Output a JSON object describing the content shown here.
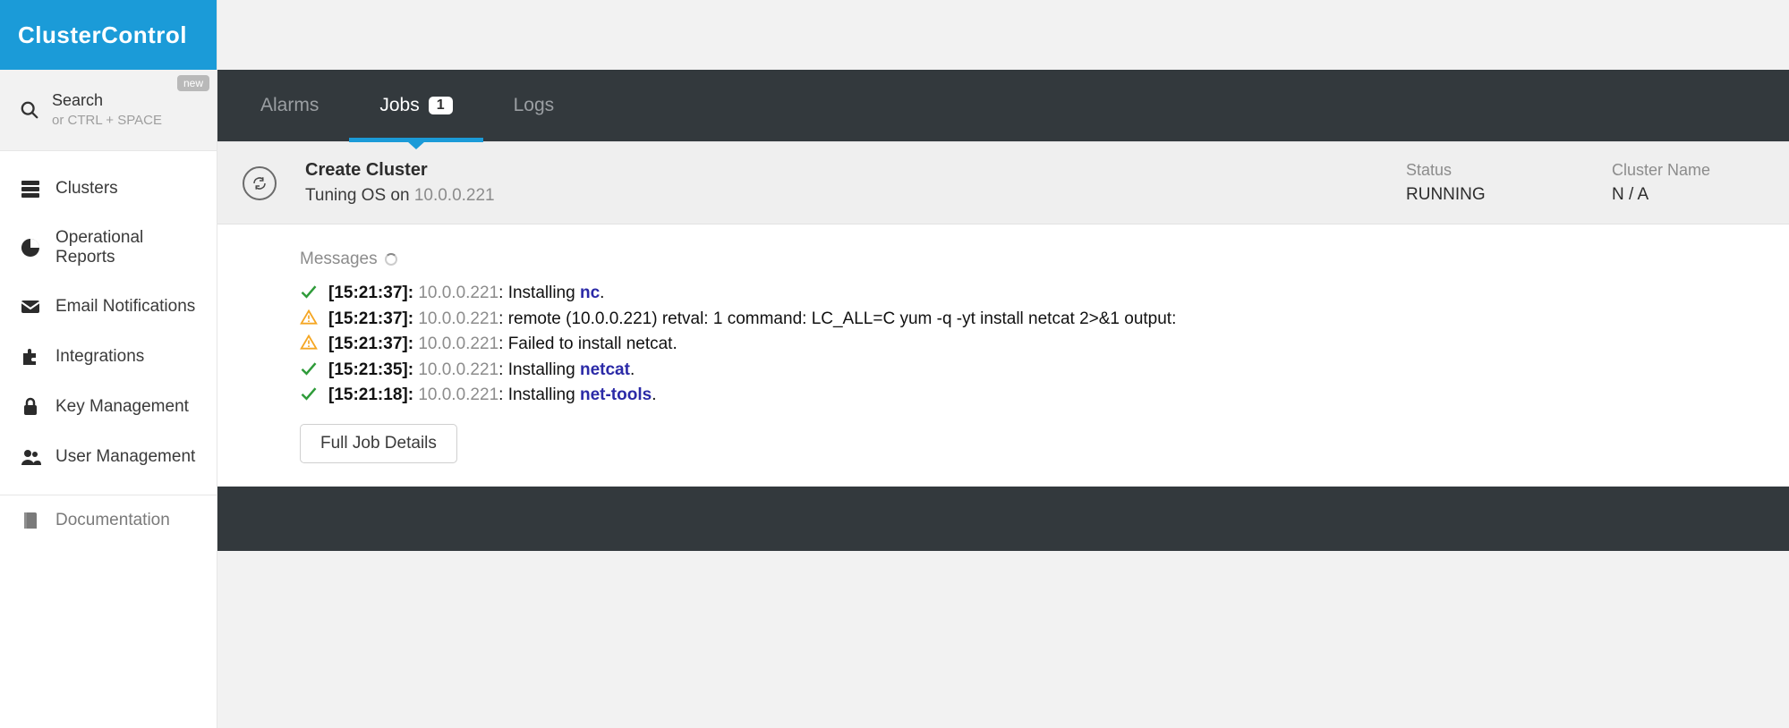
{
  "brand": "ClusterControl",
  "search": {
    "label": "Search",
    "hint": "or CTRL + SPACE",
    "new_badge": "new"
  },
  "sidebar": {
    "items": [
      {
        "label": "Clusters"
      },
      {
        "label": "Operational Reports"
      },
      {
        "label": "Email Notifications"
      },
      {
        "label": "Integrations"
      },
      {
        "label": "Key Management"
      },
      {
        "label": "User Management"
      }
    ],
    "bottom": [
      {
        "label": "Documentation"
      }
    ]
  },
  "tabs": {
    "alarms": "Alarms",
    "jobs": "Jobs",
    "jobs_count": "1",
    "logs": "Logs"
  },
  "job": {
    "title": "Create Cluster",
    "subtitle_prefix": "Tuning OS on ",
    "subtitle_ip": "10.0.0.221",
    "status_label": "Status",
    "status_value": "RUNNING",
    "cluster_name_label": "Cluster Name",
    "cluster_name_value": "N / A"
  },
  "messages": {
    "heading": "Messages",
    "button": "Full Job Details",
    "items": [
      {
        "status": "ok",
        "ts": "[15:21:37]:",
        "ip": "10.0.0.221",
        "text_before": ": Installing ",
        "pkg": "nc",
        "text_after": "."
      },
      {
        "status": "warn",
        "ts": "[15:21:37]:",
        "ip": "10.0.0.221",
        "text_before": ": remote (10.0.0.221) retval: 1 command: LC_ALL=C yum -q -yt install netcat 2>&1 output:",
        "pkg": "",
        "text_after": ""
      },
      {
        "status": "warn",
        "ts": "[15:21:37]:",
        "ip": "10.0.0.221",
        "text_before": ": Failed to install netcat.",
        "pkg": "",
        "text_after": ""
      },
      {
        "status": "ok",
        "ts": "[15:21:35]:",
        "ip": "10.0.0.221",
        "text_before": ": Installing ",
        "pkg": "netcat",
        "text_after": "."
      },
      {
        "status": "ok",
        "ts": "[15:21:18]:",
        "ip": "10.0.0.221",
        "text_before": ": Installing ",
        "pkg": "net-tools",
        "text_after": "."
      }
    ]
  }
}
